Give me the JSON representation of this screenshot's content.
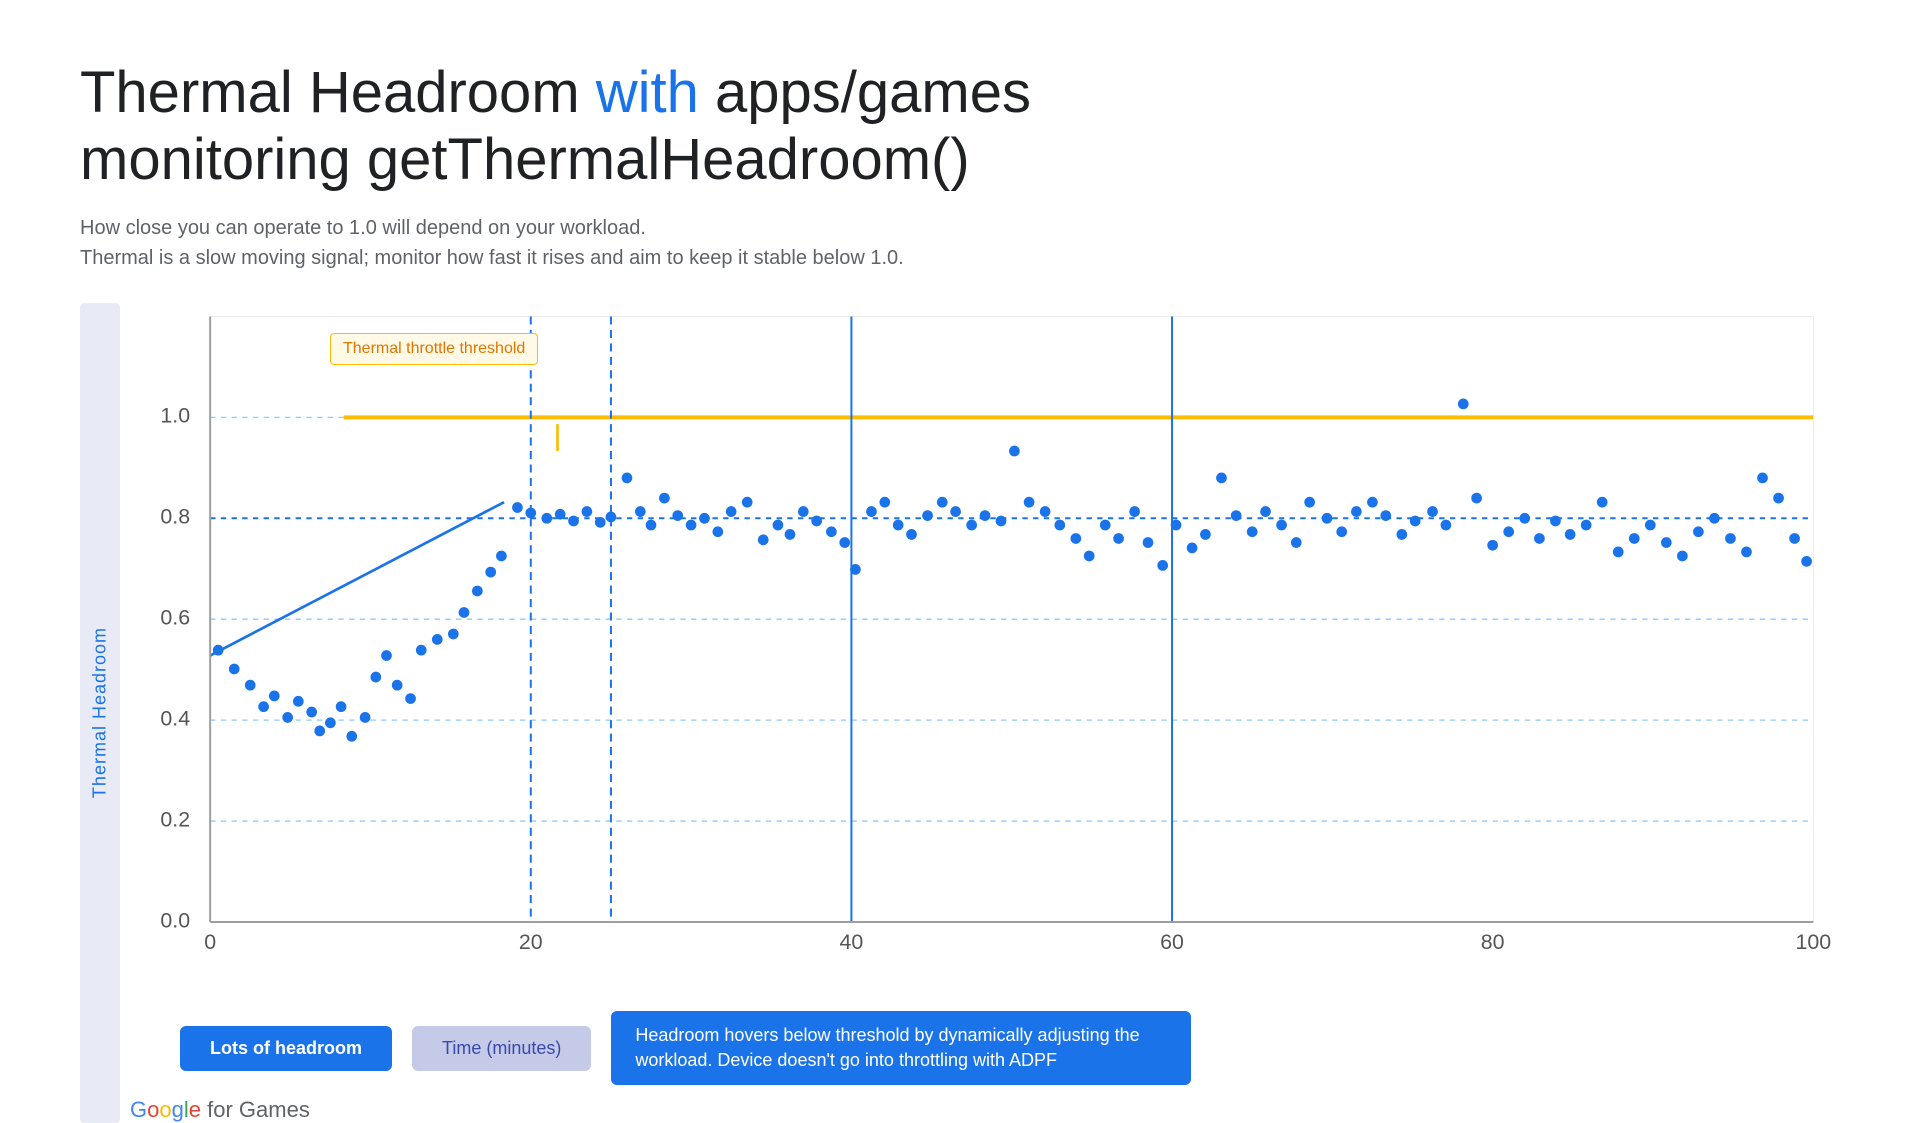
{
  "title": {
    "part1": "Thermal Headroom ",
    "highlight": "with",
    "part2": " apps/games",
    "line2": "monitoring getThermalHeadroom()"
  },
  "subtitle": {
    "line1": "How close you can operate to 1.0 will depend on your workload.",
    "line2": "Thermal is a slow moving signal; monitor how fast it rises and aim to keep it stable below 1.0."
  },
  "yAxisLabel": "Thermal Headroom",
  "xAxisLabel": "Time (minutes)",
  "tooltip": "Thermal throttle threshold",
  "labels": {
    "lots": "Lots of headroom",
    "time": "Time (minutes)",
    "headroom": "Headroom hovers below threshold by dynamically adjusting the workload. Device doesn't go into throttling with ADPF"
  },
  "googleLogo": "Google for Games",
  "yAxisTicks": [
    "0.0",
    "0.2",
    "0.4",
    "0.6",
    "0.8",
    "1.0"
  ],
  "xAxisTicks": [
    "0",
    "20",
    "40",
    "60",
    "80",
    "100"
  ],
  "colors": {
    "blue": "#1a73e8",
    "yellow": "#fbbc04",
    "gridLine": "#90caf9",
    "dot": "#1a73e8",
    "trendLine": "#1a73e8",
    "dottedLine": "#90caf9",
    "verticalLine": "#1a73e8"
  }
}
